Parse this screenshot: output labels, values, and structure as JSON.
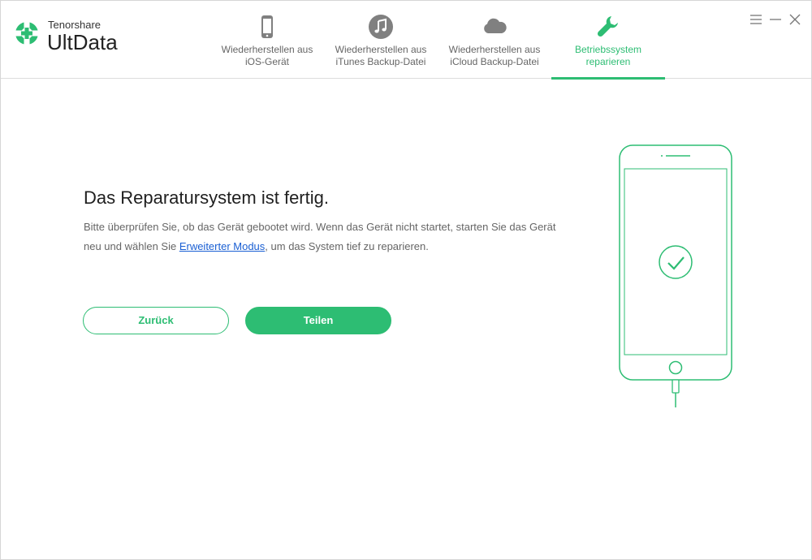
{
  "brand": {
    "company": "Tenorshare",
    "product": "UltData",
    "accent_color": "#2dbd73"
  },
  "tabs": [
    {
      "label": "Wiederherstellen aus\niOS-Gerät",
      "icon": "iphone-icon",
      "active": false
    },
    {
      "label": "Wiederherstellen aus\niTunes Backup-Datei",
      "icon": "music-note-icon",
      "active": false
    },
    {
      "label": "Wiederherstellen aus\niCloud Backup-Datei",
      "icon": "cloud-icon",
      "active": false
    },
    {
      "label": "Betriebssystem\nreparieren",
      "icon": "wrench-icon",
      "active": true
    }
  ],
  "window_controls": [
    "menu-icon",
    "minimize-icon",
    "close-icon"
  ],
  "main": {
    "title": "Das Reparatursystem ist fertig.",
    "desc_part1": "Bitte überprüfen Sie, ob das Gerät gebootet wird. Wenn das Gerät nicht startet, starten Sie das Gerät neu und wählen Sie ",
    "desc_link": "Erweiterter Modus",
    "desc_part2": ", um das System tief zu reparieren.",
    "back_label": "Zurück",
    "share_label": "Teilen"
  },
  "illustration": {
    "icon": "phone-check-icon"
  }
}
